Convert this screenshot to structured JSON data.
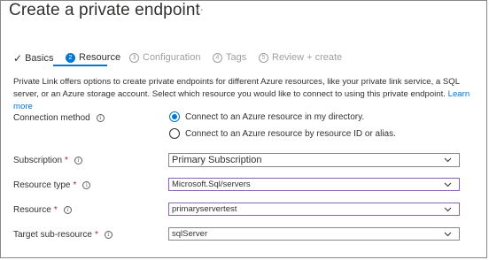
{
  "header": {
    "title": "Create a private endpoint",
    "more_label": "···"
  },
  "tabs": [
    {
      "label": "Basics",
      "state": "done",
      "icon": "checkmark-icon"
    },
    {
      "label": "Resource",
      "state": "active",
      "step": "2"
    },
    {
      "label": "Configuration",
      "state": "inactive",
      "step": "3"
    },
    {
      "label": "Tags",
      "state": "inactive",
      "step": "4"
    },
    {
      "label": "Review + create",
      "state": "inactive",
      "step": "5"
    }
  ],
  "description": {
    "text": "Private Link offers options to create private endpoints for different Azure resources, like your private link service, a SQL server, or an Azure storage account. Select which resource you would like to connect to using this private endpoint.",
    "link": "Learn more"
  },
  "form": {
    "connection_method": {
      "label": "Connection method",
      "options": [
        {
          "label": "Connect to an Azure resource in my directory.",
          "selected": true
        },
        {
          "label": "Connect to an Azure resource by resource ID or alias.",
          "selected": false
        }
      ]
    },
    "subscription": {
      "label": "Subscription",
      "required": "*",
      "value": "Primary Subscription"
    },
    "resource_type": {
      "label": "Resource type",
      "required": "*",
      "value": "Microsoft.Sql/servers"
    },
    "resource": {
      "label": "Resource",
      "required": "*",
      "value": "primaryservertest"
    },
    "target_sub_resource": {
      "label": "Target sub-resource",
      "required": "*",
      "value": "sqlServer"
    }
  },
  "colors": {
    "accent": "#0078d4",
    "required": "#a4262c",
    "focus_border": "#8764b8"
  }
}
